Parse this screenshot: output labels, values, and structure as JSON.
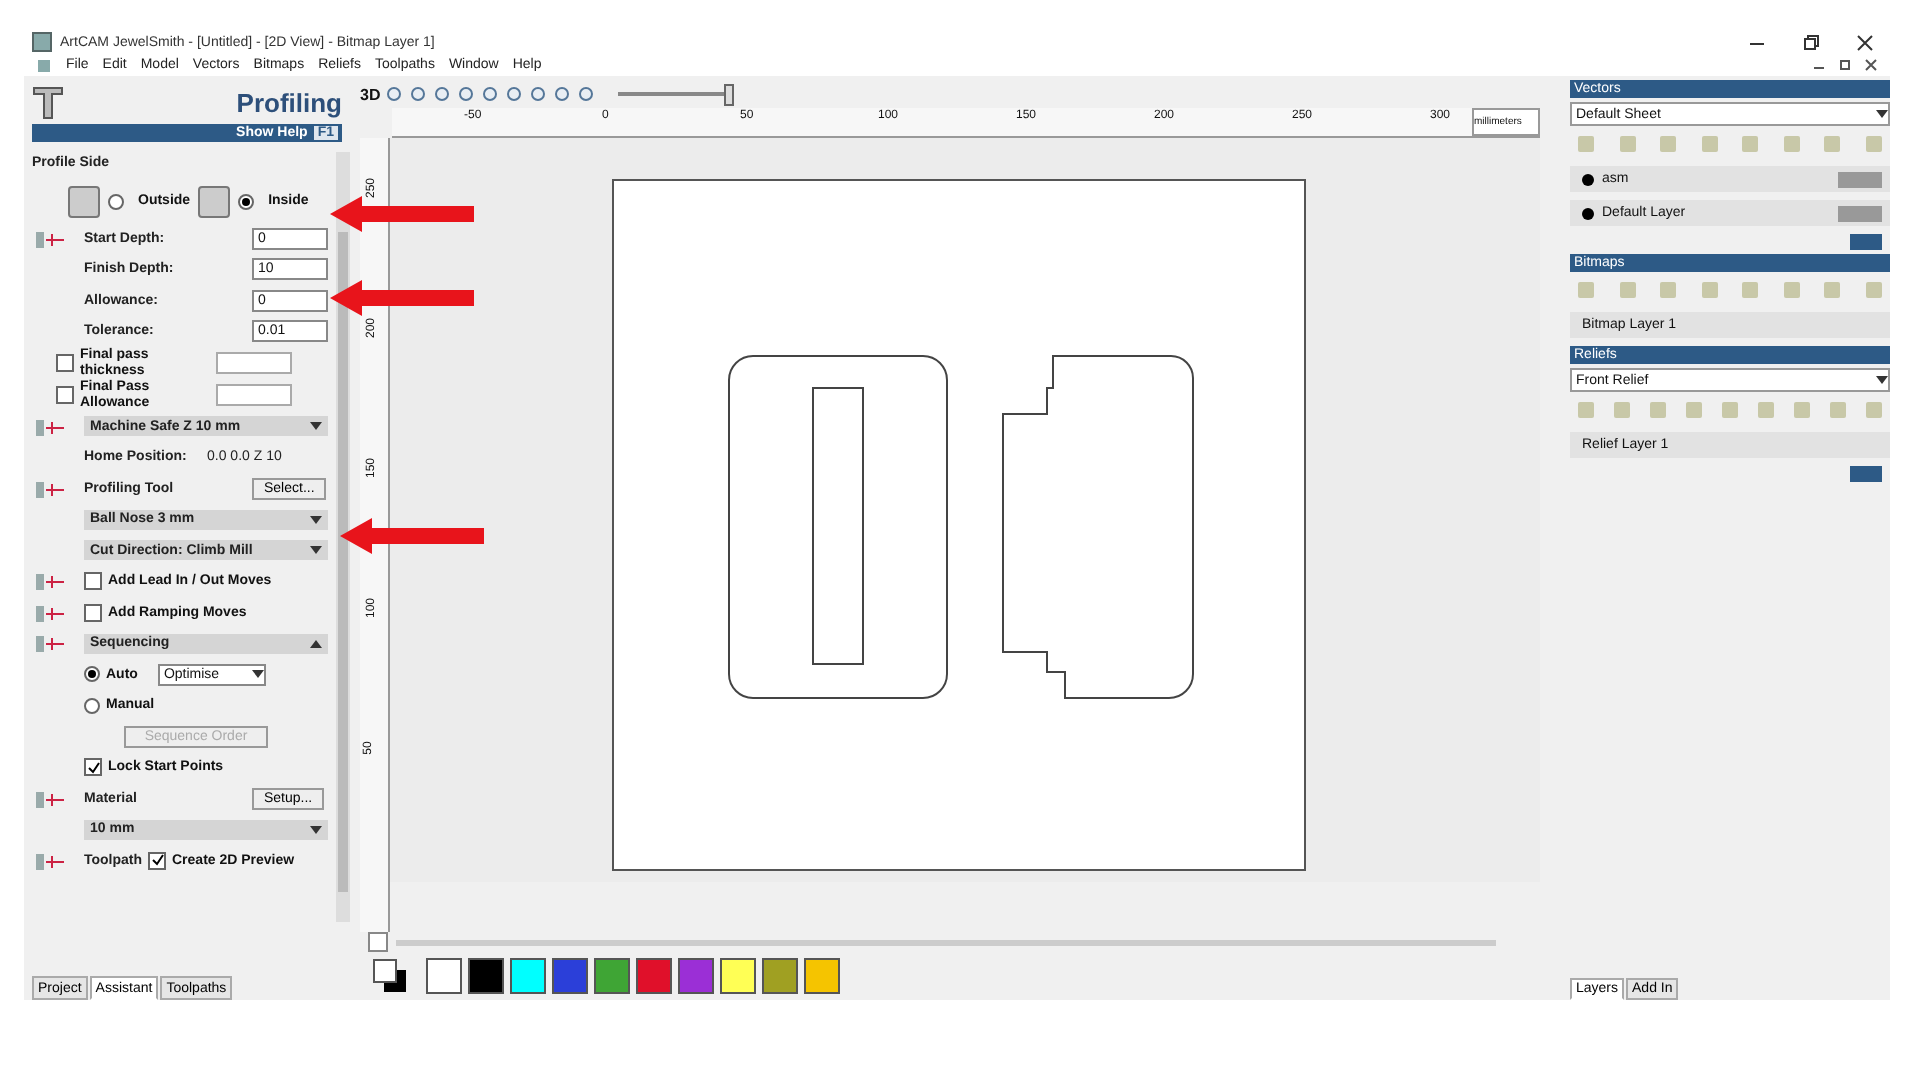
{
  "window": {
    "title": "ArtCAM JewelSmith - [Untitled] - [2D View] - Bitmap Layer 1]"
  },
  "menu": [
    "File",
    "Edit",
    "Model",
    "Vectors",
    "Bitmaps",
    "Reliefs",
    "Toolpaths",
    "Window",
    "Help"
  ],
  "left_panel": {
    "title": "Profiling",
    "help": "Show Help",
    "help_key": "F1",
    "rows": [
      {
        "kind": "label",
        "text": "Profile Side"
      },
      {
        "kind": "sides",
        "options": [
          {
            "label": "Outside",
            "selected": false
          },
          {
            "label": "Inside",
            "selected": true
          }
        ]
      },
      {
        "kind": "field",
        "label": "Start Depth:",
        "value": "0",
        "icon": true
      },
      {
        "kind": "field",
        "label": "Finish Depth:",
        "value": "10"
      },
      {
        "kind": "field",
        "label": "Allowance:",
        "value": "0"
      },
      {
        "kind": "field",
        "label": "Tolerance:",
        "value": "0.01"
      },
      {
        "kind": "checkfield",
        "label": "Final pass thickness",
        "checked": false
      },
      {
        "kind": "checkfield",
        "label": "Final Pass Allowance",
        "checked": false
      },
      {
        "kind": "bar",
        "text": "Machine Safe Z 10 mm",
        "expanded": false,
        "icon": true
      },
      {
        "kind": "info",
        "label": "Home Position:",
        "value": "0.0 0.0 Z 10"
      },
      {
        "kind": "button_row",
        "label": "Profiling Tool",
        "button": "Select...",
        "icon": true
      },
      {
        "kind": "bar",
        "text": "Ball Nose 3 mm",
        "expanded": false
      },
      {
        "kind": "bar",
        "text": "Cut Direction: Climb Mill",
        "expanded": false
      },
      {
        "kind": "check",
        "label": "Add Lead In / Out Moves",
        "checked": false,
        "icon": true
      },
      {
        "kind": "check",
        "label": "Add Ramping Moves",
        "checked": false,
        "icon": true
      },
      {
        "kind": "bar",
        "text": "Sequencing",
        "expanded": true,
        "icon": true
      },
      {
        "kind": "radio_select",
        "label": "Auto",
        "selected": true,
        "value": "Optimise"
      },
      {
        "kind": "radio",
        "label": "Manual",
        "selected": false
      },
      {
        "kind": "wide_button",
        "label": "Sequence Order",
        "disabled": true
      },
      {
        "kind": "check",
        "label": "Lock Start Points",
        "checked": true
      },
      {
        "kind": "button_row",
        "label": "Material",
        "button": "Setup...",
        "icon": true
      },
      {
        "kind": "bar",
        "text": "10 mm",
        "expanded": false
      },
      {
        "kind": "toolpath",
        "label": "Toolpath",
        "check_label": "Create 2D Preview",
        "checked": true,
        "icon": true
      }
    ],
    "tabs": [
      {
        "label": "Project",
        "selected": false
      },
      {
        "label": "Assistant",
        "selected": true
      },
      {
        "label": "Toolpaths",
        "selected": false
      }
    ]
  },
  "view": {
    "toolbar_label": "3D",
    "zoom": {
      "level": 0.95
    },
    "ruler": [
      "-50",
      "0",
      "50",
      "100",
      "150",
      "200",
      "250",
      "300"
    ],
    "units": "millimeters",
    "vertical_ruler": [
      "250",
      "200",
      "150",
      "100",
      "50"
    ]
  },
  "palette": [
    {
      "color": "#ffffff"
    },
    {
      "color": "#000000"
    },
    {
      "color": "#00ffff"
    },
    {
      "color": "#2b3fd9"
    },
    {
      "color": "#3fa535"
    },
    {
      "color": "#e0102a"
    },
    {
      "color": "#9b2fd6"
    },
    {
      "color": "#ffff55"
    },
    {
      "color": "#a0a022"
    },
    {
      "color": "#f5c400"
    }
  ],
  "right_panel": {
    "vectors": {
      "title": "Vectors",
      "sheet": "Default Sheet",
      "layers": [
        {
          "name": "asm"
        },
        {
          "name": "Default Layer"
        }
      ]
    },
    "bitmaps": {
      "title": "Bitmaps",
      "layers": [
        {
          "name": "Bitmap Layer 1"
        }
      ]
    },
    "reliefs": {
      "title": "Reliefs",
      "relief": "Front Relief",
      "layers": [
        {
          "name": "Relief Layer 1"
        }
      ]
    },
    "tabs": [
      {
        "label": "Layers",
        "selected": true
      },
      {
        "label": "Add In",
        "selected": false
      }
    ]
  },
  "annotations": [
    {
      "kind": "arrow"
    },
    {
      "kind": "arrow"
    },
    {
      "kind": "arrow"
    }
  ]
}
